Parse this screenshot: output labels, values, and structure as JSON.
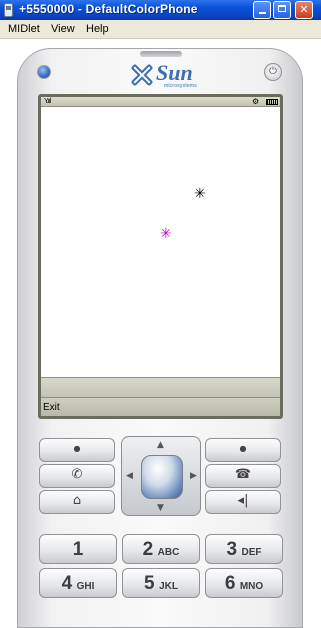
{
  "window": {
    "title": "+5550000 - DefaultColorPhone",
    "minimize_icon": "minimize-icon",
    "maximize_icon": "maximize-icon",
    "close_icon": "close-icon",
    "close_label": "✕"
  },
  "menubar": {
    "items": [
      {
        "label": "MIDlet"
      },
      {
        "label": "View"
      },
      {
        "label": "Help"
      }
    ]
  },
  "phone": {
    "brand": "Sun",
    "brand_sub": "microsystems",
    "power_glyph": "⏻",
    "status": {
      "signal": "Y.ııl",
      "gear_glyph": "⚙",
      "icons": [
        "signal-icon",
        "settings-icon",
        "battery-icon"
      ]
    },
    "canvas": {
      "stars": [
        {
          "glyph": "✳",
          "color": "#000000"
        },
        {
          "glyph": "✳",
          "color": "#c000c0"
        }
      ]
    },
    "softkeys": {
      "left_label": "Exit"
    },
    "keys": {
      "call_glyph": "✆",
      "end_glyph": "☎",
      "home_glyph": "⌂",
      "back_glyph": "◂|",
      "dot_glyph": "●",
      "up_arrow": "▲",
      "down_arrow": "▼",
      "left_arrow": "◀",
      "right_arrow": "▶",
      "digits": [
        {
          "digit": "1",
          "letters": ""
        },
        {
          "digit": "2",
          "letters": "ABC"
        },
        {
          "digit": "3",
          "letters": "DEF"
        },
        {
          "digit": "4",
          "letters": "GHI"
        },
        {
          "digit": "5",
          "letters": "JKL"
        },
        {
          "digit": "6",
          "letters": "MNO"
        }
      ]
    }
  }
}
